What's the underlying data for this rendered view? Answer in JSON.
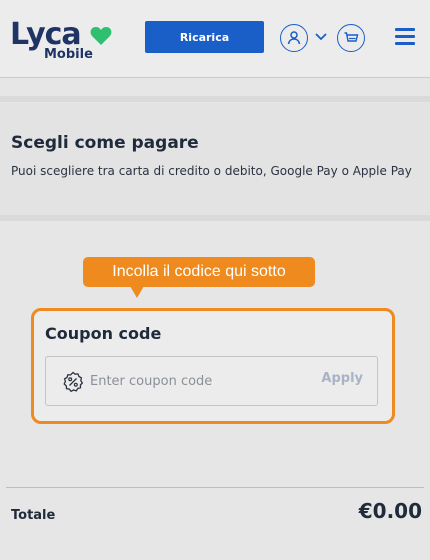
{
  "header": {
    "logo_text": "Lyca",
    "logo_sub": "Mobile",
    "topup_label": "Ricarica",
    "icons": [
      "user-icon",
      "chevron-down-icon",
      "cart-icon",
      "hamburger-menu-icon"
    ],
    "accent_color": "#1a5ec8",
    "logo_heart_color": "#2fbf71"
  },
  "payment": {
    "title": "Scegli come pagare",
    "description": "Puoi scegliere tra carta di credito o debito, Google Pay o Apple Pay"
  },
  "tooltip": {
    "text": "Incolla il codice qui sotto",
    "color": "#ef8a1f"
  },
  "coupon": {
    "title": "Coupon code",
    "input_value": "",
    "placeholder": "Enter coupon code",
    "apply_label": "Apply",
    "icon": "discount-percent-icon"
  },
  "total": {
    "label": "Totale",
    "value": "€0.00"
  }
}
